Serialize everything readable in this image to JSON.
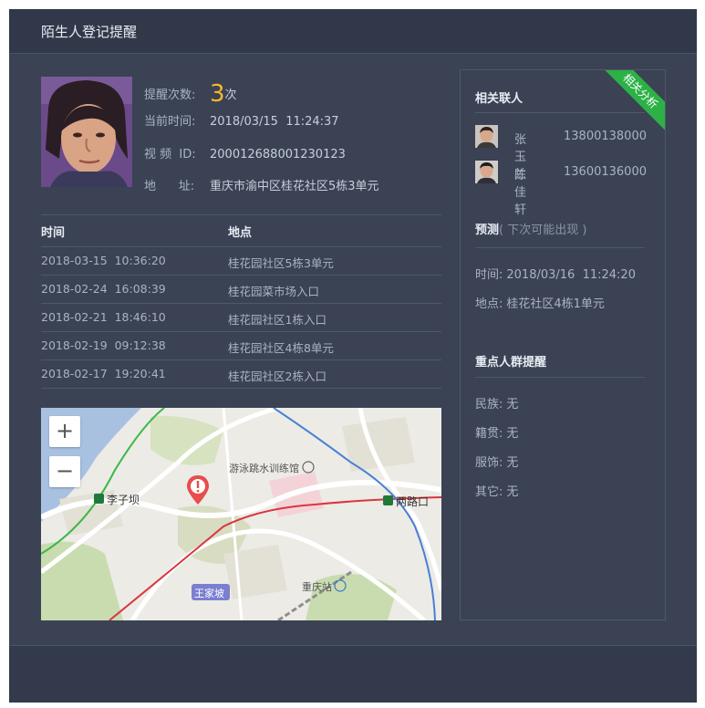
{
  "title": "陌生人登记提醒",
  "person": {
    "count_label": "提醒次数:",
    "count_value": "3",
    "count_unit": "次",
    "time_label": "当前时间:",
    "time_value": "2018/03/15  11:24:37",
    "video_label": "视 频  ID:",
    "video_value": "200012688001230123",
    "address_label": "地      址:",
    "address_value": "重庆市渝中区桂花社区5栋3单元"
  },
  "history": {
    "headers": [
      "时间",
      "地点"
    ],
    "rows": [
      {
        "time": "2018-03-15  10:36:20",
        "place": "桂花园社区5栋3单元"
      },
      {
        "time": "2018-02-24  16:08:39",
        "place": "桂花园菜市场入口"
      },
      {
        "time": "2018-02-21  18:46:10",
        "place": "桂花园社区1栋入口"
      },
      {
        "time": "2018-02-19  09:12:38",
        "place": "桂花园社区4栋8单元"
      },
      {
        "time": "2018-02-17  19:20:41",
        "place": "桂花园社区2栋入口"
      }
    ]
  },
  "map": {
    "zoom_in": "+",
    "zoom_out": "−",
    "labels": {
      "lizi": "李子坝",
      "swim": "游泳跳水训练馆",
      "lianglu": "两路口",
      "wangjia": "王家坡",
      "station": "重庆站"
    }
  },
  "side": {
    "ribbon": "相关分析",
    "contacts_title": "相关联人",
    "contacts": [
      {
        "name": "张玉兰",
        "phone": "13800138000"
      },
      {
        "name": "陈佳轩",
        "phone": "13600136000"
      }
    ],
    "predict_title": "预测",
    "predict_sub": "( 下次可能出现 )",
    "predict_time_label": "时间:",
    "predict_time": "2018/03/16  11:24:20",
    "predict_place_label": "地点:",
    "predict_place": "桂花社区4栋1单元",
    "focus_title": "重点人群提醒",
    "focus": [
      {
        "label": "民族:",
        "value": "无"
      },
      {
        "label": "籍贯:",
        "value": "无"
      },
      {
        "label": "服饰:",
        "value": "无"
      },
      {
        "label": "其它:",
        "value": "无"
      }
    ]
  },
  "colors": {
    "background": "#3a4254",
    "accent_count": "#f5b82e",
    "ribbon": "#2cb146",
    "metro_red": "#d9363e",
    "metro_blue": "#4a7fd6",
    "metro_green": "#3bb84a"
  }
}
